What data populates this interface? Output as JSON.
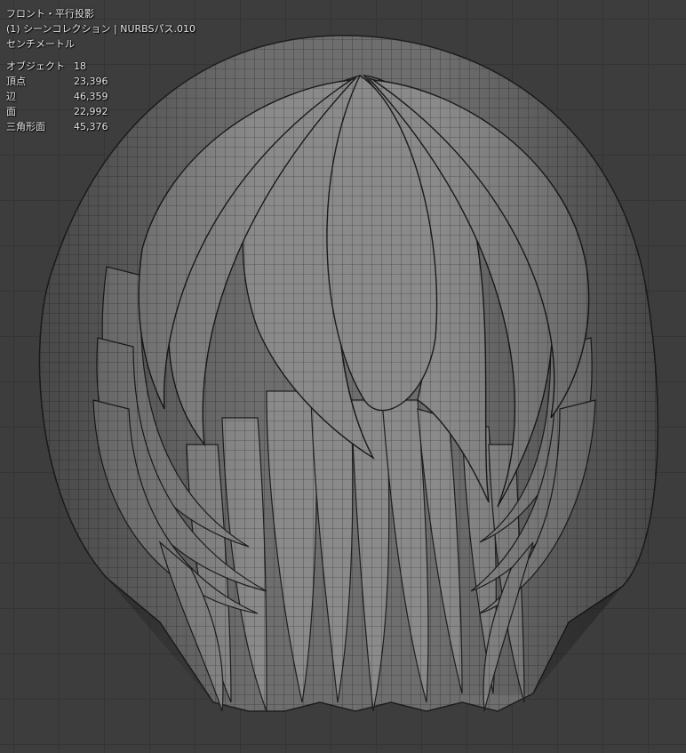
{
  "viewport": {
    "view_name": "フロント・平行投影",
    "collection_line": "(1) シーンコレクション | NURBSパス.010",
    "units": "センチメートル",
    "stats": [
      {
        "label": "オブジェクト",
        "value": "18"
      },
      {
        "label": "頂点",
        "value": "23,396"
      },
      {
        "label": "辺",
        "value": "46,359"
      },
      {
        "label": "面",
        "value": "22,992"
      },
      {
        "label": "三角形面",
        "value": "45,376"
      }
    ]
  },
  "colors": {
    "background": "#3d3d3d",
    "grid": "#353535",
    "mesh_fill": "#8c8c8c",
    "wireframe": "#2a2a2a"
  }
}
